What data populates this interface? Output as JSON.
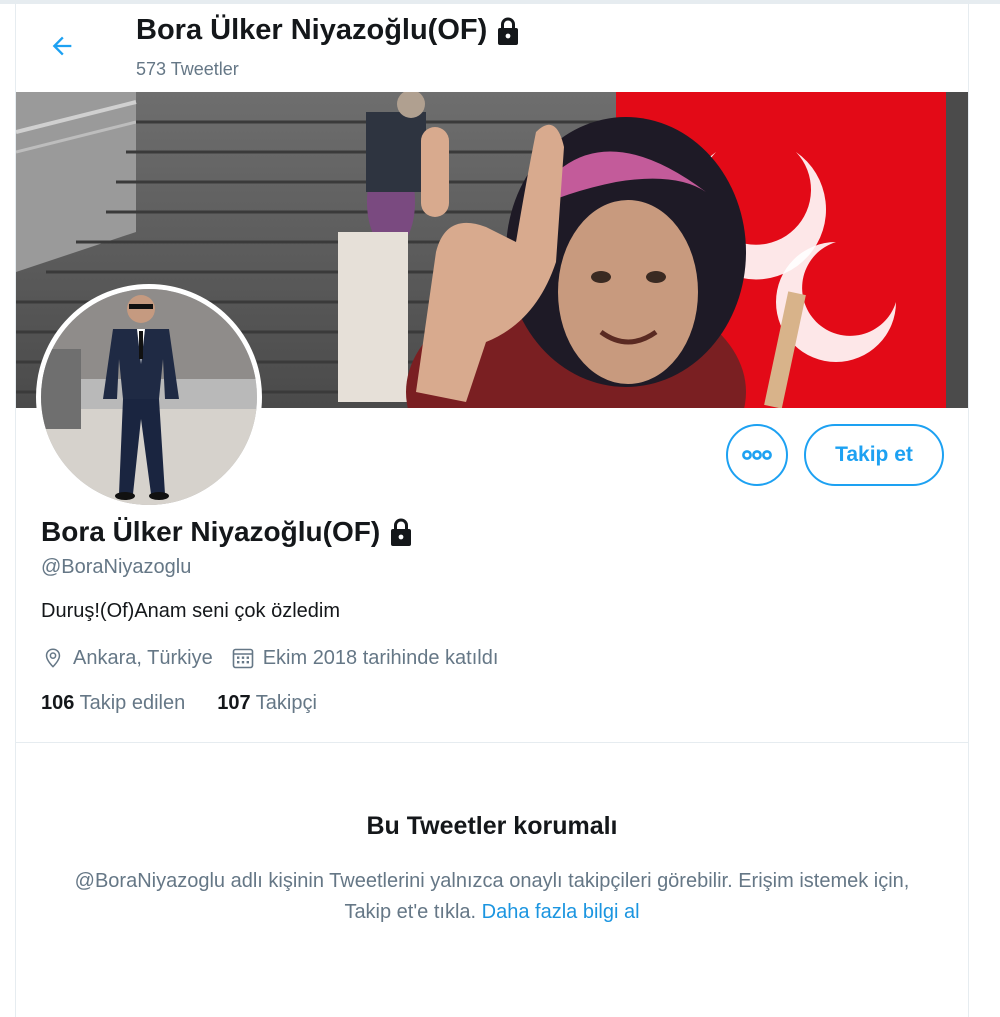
{
  "header": {
    "title": "Bora Ülker Niyazoğlu(OF)",
    "tweet_count": "573 Tweetler"
  },
  "profile": {
    "name": "Bora Ülker Niyazoğlu(OF)",
    "handle": "@BoraNiyazoglu",
    "bio": "Duruş!(Of)Anam seni çok özledim",
    "location": "Ankara, Türkiye",
    "joined": "Ekim 2018 tarihinde katıldı",
    "following_count": "106",
    "following_label": "Takip edilen",
    "followers_count": "107",
    "followers_label": "Takipçi"
  },
  "actions": {
    "follow_label": "Takip et"
  },
  "protected": {
    "title": "Bu Tweetler korumalı",
    "text": "@BoraNiyazoglu adlı kişinin Tweetlerini yalnızca onaylı takipçileri görebilir. Erişim istemek için, Takip et'e tıkla.",
    "link": "Daha fazla bilgi al"
  },
  "icons": {
    "back": "arrow-left-icon",
    "lock": "lock-icon",
    "more": "more-icon",
    "location": "location-pin-icon",
    "calendar": "calendar-icon"
  },
  "colors": {
    "accent": "#1da1f2",
    "link": "#1b95e0",
    "secondary_text": "#657786",
    "primary_text": "#14171a",
    "border": "#e6ecf0",
    "flag_red": "#e30a17"
  }
}
